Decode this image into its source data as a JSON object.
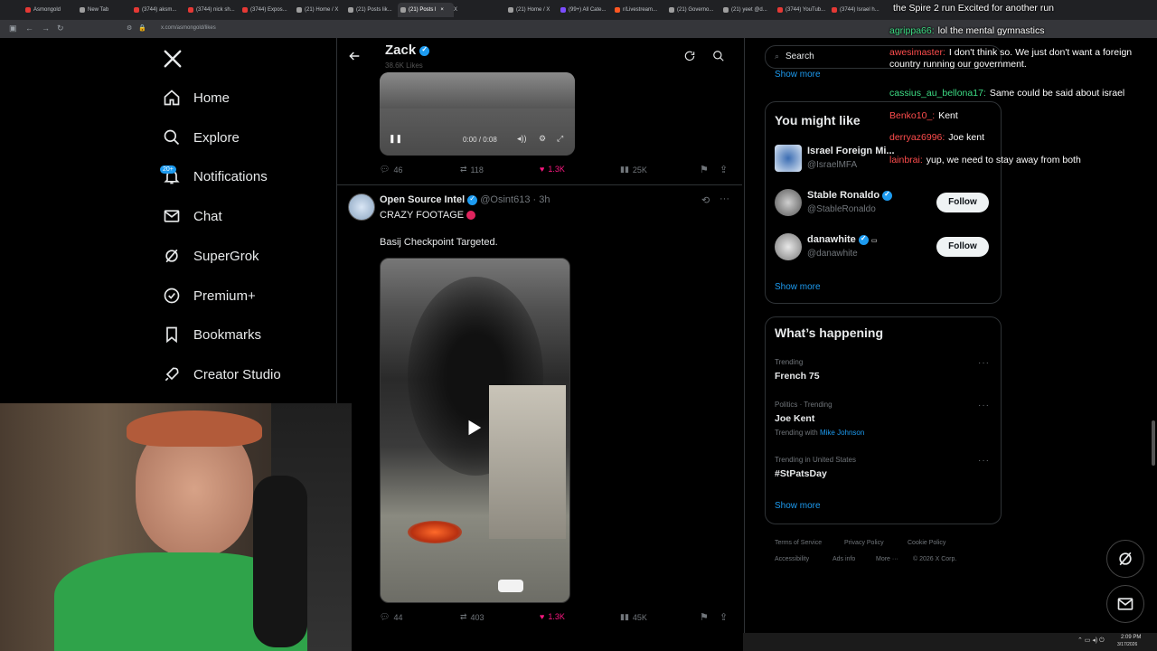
{
  "browser": {
    "tabs": [
      {
        "title": "Asmongold",
        "color": "#e53935"
      },
      {
        "title": "New Tab",
        "color": "#9e9e9e"
      },
      {
        "title": "(3744) aksm...",
        "color": "#e53935"
      },
      {
        "title": "(3744) nick sh...",
        "color": "#e53935"
      },
      {
        "title": "(3744) Expos...",
        "color": "#e53935"
      },
      {
        "title": "(21) Home / X",
        "color": "#9e9e9e"
      },
      {
        "title": "(21) Posts lik...",
        "color": "#9e9e9e"
      },
      {
        "title": "(21) Posts l",
        "color": "#9e9e9e"
      },
      {
        "title": "X",
        "color": "#9e9e9e"
      },
      {
        "title": "(21) Home / X",
        "color": "#9e9e9e"
      },
      {
        "title": "(99+) All Cate...",
        "color": "#7c4dff"
      },
      {
        "title": "r/Livestream...",
        "color": "#ff5722"
      },
      {
        "title": "(21) Governo...",
        "color": "#9e9e9e"
      },
      {
        "title": "(21) yeet @d...",
        "color": "#9e9e9e"
      },
      {
        "title": "(3744) YouTub...",
        "color": "#e53935"
      },
      {
        "title": "(3744) Israel h...",
        "color": "#e53935"
      }
    ],
    "url": "x.com/asmongold/likes"
  },
  "nav": {
    "items": [
      {
        "label": "Home",
        "icon": "home-icon"
      },
      {
        "label": "Explore",
        "icon": "search-icon"
      },
      {
        "label": "Notifications",
        "icon": "bell-icon"
      },
      {
        "label": "Chat",
        "icon": "mail-icon"
      },
      {
        "label": "SuperGrok",
        "icon": "grok-icon"
      },
      {
        "label": "Premium+",
        "icon": "verified-badge-icon"
      },
      {
        "label": "Bookmarks",
        "icon": "bookmark-icon"
      },
      {
        "label": "Creator Studio",
        "icon": "rocket-icon"
      }
    ],
    "notif_badge": "20+"
  },
  "profile_header": {
    "name": "Zack",
    "likes": "38.6K Likes"
  },
  "video1": {
    "time": "0:00 / 0:08"
  },
  "post1_metrics": {
    "replies": "46",
    "reposts": "118",
    "likes": "1.3K",
    "views": "25K"
  },
  "post2": {
    "author": "Open Source Intel",
    "handle": "@Osint613",
    "time": "3h",
    "line1": "CRAZY FOOTAGE",
    "line2": "Basij Checkpoint Targeted.",
    "metrics": {
      "replies": "44",
      "reposts": "403",
      "likes": "1.3K",
      "views": "45K"
    }
  },
  "right": {
    "search_placeholder": "Search",
    "show_more_top": "Show more",
    "might_like_title": "You might like",
    "suggestions": [
      {
        "name": "Israel Foreign Mi...",
        "handle": "@IsraelMFA"
      },
      {
        "name": "Stable Ronaldo",
        "handle": "@StableRonaldo",
        "follow": "Follow"
      },
      {
        "name": "danawhite",
        "handle": "@danawhite",
        "follow": "Follow"
      }
    ],
    "show_more_1": "Show more",
    "happening_title": "What’s happening",
    "trends": [
      {
        "context": "Trending",
        "title": "French 75"
      },
      {
        "context": "Politics · Trending",
        "title": "Joe Kent",
        "extra_prefix": "Trending with ",
        "extra_link": "Mike Johnson"
      },
      {
        "context": "Trending in United States",
        "title": "#StPatsDay"
      }
    ],
    "show_more_2": "Show more",
    "footer": [
      "Terms of Service",
      "Privacy Policy",
      "Cookie Policy",
      "Accessibility",
      "Ads info",
      "More ···",
      "© 2026 X Corp."
    ]
  },
  "chat": [
    {
      "user": "",
      "color": "#ffffff",
      "msg": "the Spire 2 run Excited for another run"
    },
    {
      "user": "agrippa66:",
      "color": "#3ddc84",
      "msg": "lol the mental gymnastics"
    },
    {
      "user": "awesimaster:",
      "color": "#ff4d4d",
      "msg": "I don't think so. We just don't want a foreign country running our government."
    },
    {
      "user": "cassius_au_bellona17:",
      "color": "#3ddc84",
      "msg": "Same could be said about israel"
    },
    {
      "user": "Benko10_:",
      "color": "#ff4d4d",
      "msg": "Kent"
    },
    {
      "user": "derryaz6996:",
      "color": "#ff4d4d",
      "msg": "Joe kent"
    },
    {
      "user": "lainbrai:",
      "color": "#ff4d4d",
      "msg": "yup, we need to stay away from both"
    }
  ],
  "taskbar": {
    "time": "2:09 PM",
    "date": "3/17/2026"
  },
  "colors": {
    "accent": "#1d9bf0",
    "like": "#f91880",
    "bg": "#000000"
  }
}
